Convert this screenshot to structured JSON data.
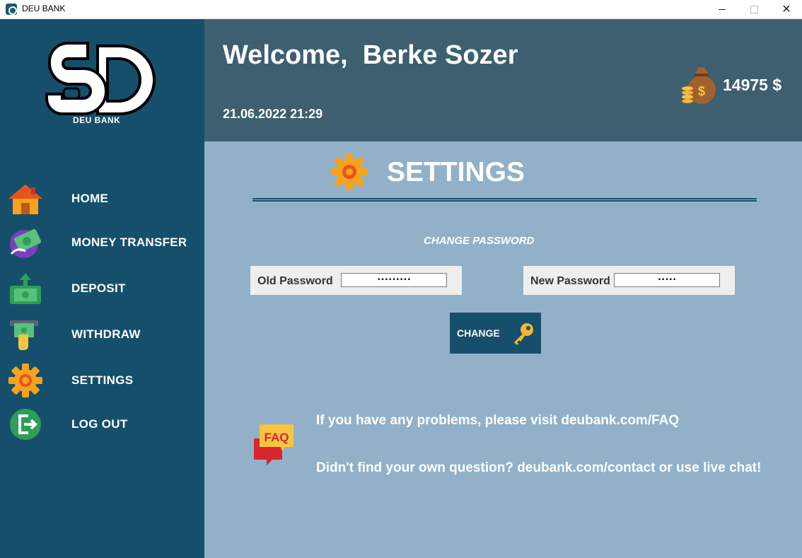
{
  "window": {
    "title": "DEU BANK",
    "minimize_icon": "minimize-icon",
    "maximize_icon": "maximize-icon",
    "close_icon": "close-icon"
  },
  "sidebar": {
    "logo": {
      "monogram": "SD",
      "text": "DEU BANK"
    },
    "items": [
      {
        "label": "HOME",
        "icon": "home-icon"
      },
      {
        "label": "MONEY TRANSFER",
        "icon": "money-transfer-icon"
      },
      {
        "label": "DEPOSIT",
        "icon": "deposit-icon"
      },
      {
        "label": "WITHDRAW",
        "icon": "withdraw-icon"
      },
      {
        "label": "SETTINGS",
        "icon": "gear-icon"
      },
      {
        "label": "LOG OUT",
        "icon": "logout-icon"
      }
    ]
  },
  "header": {
    "welcome": "Welcome,  Berke Sozer",
    "datetime": "21.06.2022 21:29",
    "balance": "14975 $",
    "balance_icon": "money-bag-icon"
  },
  "settings": {
    "title": "SETTINGS",
    "section_heading": "CHANGE PASSWORD",
    "old_password_label": "Old Password",
    "old_password_value": "•••••••••",
    "new_password_label": "New Password",
    "new_password_value": "•••••",
    "change_button": "CHANGE",
    "faq_line_1": "If you have any problems, please visit deubank.com/FAQ",
    "faq_line_2": "Didn't find your own question? deubank.com/contact or use live chat!",
    "faq_badge": "FAQ"
  },
  "colors": {
    "sidebar": "#164f6b",
    "header": "#3d5f70",
    "content": "#92b1c8",
    "accent_orange": "#f7a21b"
  }
}
